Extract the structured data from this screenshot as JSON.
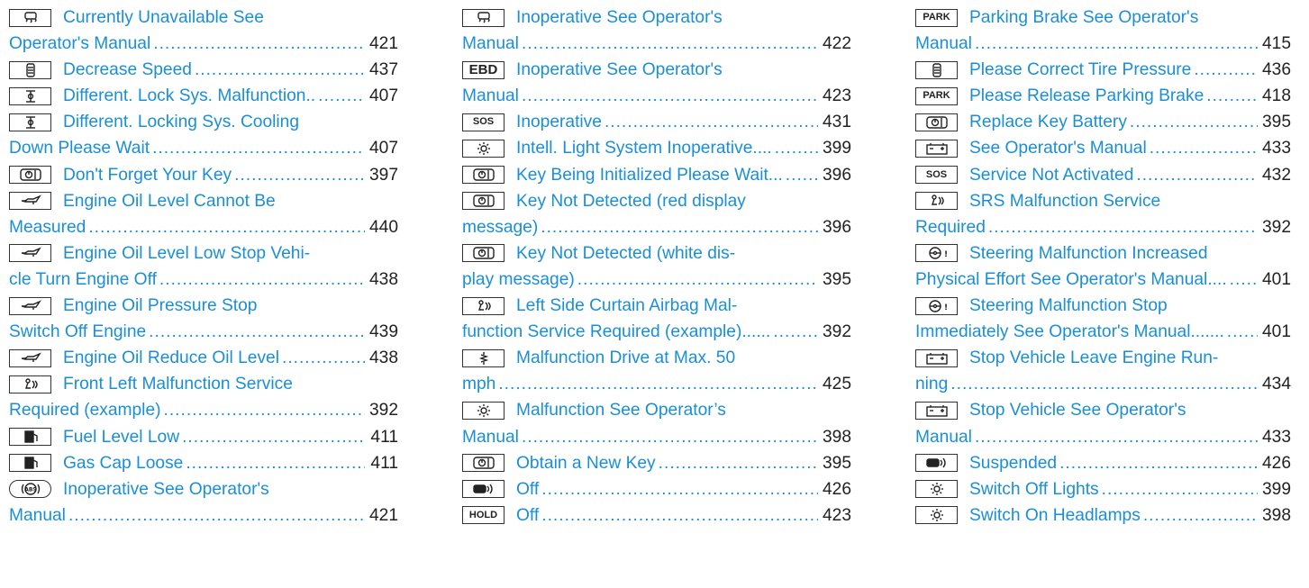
{
  "columns": [
    {
      "entries": [
        {
          "icon": "car-skid-icon",
          "lines": [
            "Currently Unavailable See",
            "Operator's Manual"
          ],
          "page": "421"
        },
        {
          "icon": "tire-speed-icon",
          "lines": [
            "Decrease Speed"
          ],
          "page": "437"
        },
        {
          "icon": "differential-lock-icon",
          "lines": [
            "Different. Lock Sys. Malfunction.."
          ],
          "page": "407"
        },
        {
          "icon": "differential-lock-icon",
          "lines": [
            "Different. Locking Sys. Cooling",
            "Down Please Wait"
          ],
          "page": "407"
        },
        {
          "icon": "key-icon",
          "lines": [
            "Don't Forget Your Key"
          ],
          "page": "397"
        },
        {
          "icon": "oil-can-icon",
          "lines": [
            "Engine Oil Level Cannot Be",
            "Measured"
          ],
          "page": "440"
        },
        {
          "icon": "oil-can-icon",
          "lines": [
            "Engine Oil Level Low Stop Vehi-",
            "cle Turn Engine Off"
          ],
          "page": "438"
        },
        {
          "icon": "oil-can-icon",
          "lines": [
            "Engine Oil Pressure Stop",
            "Switch Off Engine"
          ],
          "page": "439"
        },
        {
          "icon": "oil-can-icon",
          "lines": [
            "Engine Oil Reduce Oil Level"
          ],
          "page": "438"
        },
        {
          "icon": "airbag-icon",
          "lines": [
            "Front Left Malfunction Service",
            "Required (example)"
          ],
          "page": "392"
        },
        {
          "icon": "fuel-pump-icon",
          "lines": [
            "Fuel Level Low"
          ],
          "page": "411"
        },
        {
          "icon": "fuel-pump-icon",
          "lines": [
            "Gas Cap Loose"
          ],
          "page": "411"
        },
        {
          "icon": "abs-icon",
          "lines": [
            "Inoperative See Operator's",
            "Manual"
          ],
          "page": "421"
        }
      ]
    },
    {
      "entries": [
        {
          "icon": "car-skid-icon",
          "lines": [
            "Inoperative See Operator's",
            "Manual"
          ],
          "page": "422"
        },
        {
          "icon": "ebd-icon",
          "lines": [
            "Inoperative See Operator's",
            "Manual"
          ],
          "page": "423"
        },
        {
          "icon": "sos-icon",
          "lines": [
            "Inoperative"
          ],
          "page": "431"
        },
        {
          "icon": "light-icon",
          "lines": [
            "Intell. Light System Inoperative...."
          ],
          "page": "399"
        },
        {
          "icon": "key-icon",
          "lines": [
            "Key Being Initialized Please Wait..."
          ],
          "page": "396"
        },
        {
          "icon": "key-icon",
          "lines": [
            "Key Not Detected (red display",
            "message)"
          ],
          "page": "396"
        },
        {
          "icon": "key-icon",
          "lines": [
            "Key Not Detected (white dis-",
            "play message)"
          ],
          "page": "395"
        },
        {
          "icon": "airbag-icon",
          "lines": [
            "Left Side Curtain Airbag Mal-",
            "function Service Required (example)......"
          ],
          "page": "392"
        },
        {
          "icon": "suspension-icon",
          "lines": [
            "Malfunction Drive at Max. 50",
            "mph"
          ],
          "page": "425"
        },
        {
          "icon": "light-icon",
          "lines": [
            "Malfunction See Operator’s",
            "Manual"
          ],
          "page": "398"
        },
        {
          "icon": "key-icon",
          "lines": [
            "Obtain a New Key"
          ],
          "page": "395"
        },
        {
          "icon": "car-sensor-icon",
          "lines": [
            "Off"
          ],
          "page": "426"
        },
        {
          "icon": "hold-icon",
          "lines": [
            "Off"
          ],
          "page": "423"
        }
      ]
    },
    {
      "entries": [
        {
          "icon": "park-icon",
          "lines": [
            "Parking Brake See Operator's",
            "Manual"
          ],
          "page": "415"
        },
        {
          "icon": "tire-speed-icon",
          "lines": [
            "Please Correct Tire Pressure"
          ],
          "page": "436"
        },
        {
          "icon": "park-icon",
          "lines": [
            "Please Release Parking Brake"
          ],
          "page": "418"
        },
        {
          "icon": "key-icon",
          "lines": [
            "Replace Key Battery"
          ],
          "page": "395"
        },
        {
          "icon": "battery-icon",
          "lines": [
            "See Operator's Manual"
          ],
          "page": "433"
        },
        {
          "icon": "sos-icon",
          "lines": [
            "Service Not Activated"
          ],
          "page": "432"
        },
        {
          "icon": "airbag-icon",
          "lines": [
            "SRS Malfunction Service",
            "Required"
          ],
          "page": "392"
        },
        {
          "icon": "steering-icon",
          "lines": [
            "Steering Malfunction Increased",
            "Physical Effort See Operator's Manual...."
          ],
          "page": "401"
        },
        {
          "icon": "steering-icon",
          "lines": [
            "Steering Malfunction Stop",
            "Immediately See Operator's Manual......."
          ],
          "page": "401"
        },
        {
          "icon": "battery-icon",
          "lines": [
            "Stop Vehicle Leave Engine Run-",
            "ning"
          ],
          "page": "434"
        },
        {
          "icon": "battery-icon",
          "lines": [
            "Stop Vehicle See Operator's",
            "Manual"
          ],
          "page": "433"
        },
        {
          "icon": "car-sensor-icon",
          "lines": [
            "Suspended"
          ],
          "page": "426"
        },
        {
          "icon": "light-icon",
          "lines": [
            "Switch Off Lights"
          ],
          "page": "399"
        },
        {
          "icon": "light-icon",
          "lines": [
            "Switch On Headlamps"
          ],
          "page": "398"
        }
      ]
    }
  ],
  "icon_text": {
    "ebd-icon": "EBD",
    "sos-icon": "SOS",
    "park-icon": "PARK",
    "hold-icon": "HOLD"
  },
  "colors": {
    "link": "#1a8fd6",
    "page_number": "#222222",
    "icon_border": "#333333"
  }
}
